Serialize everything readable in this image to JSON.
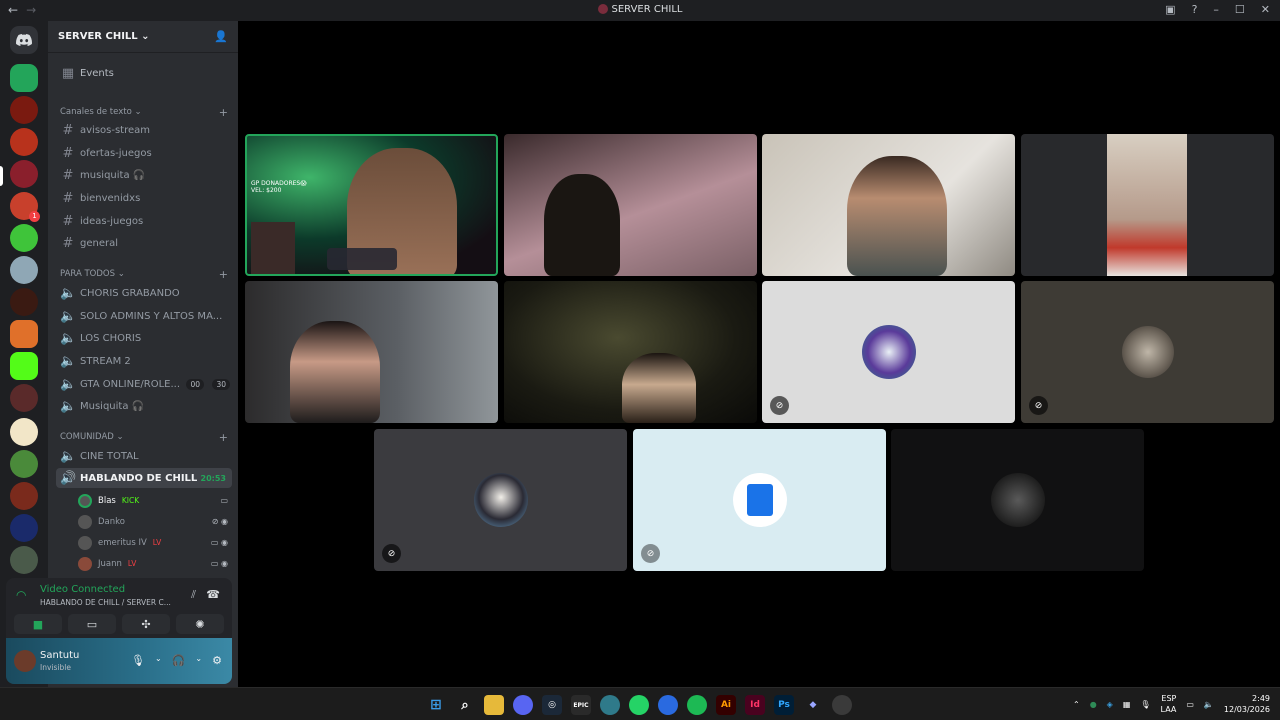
{
  "window": {
    "title": "SERVER CHILL",
    "back": "←",
    "forward": "→"
  },
  "server_header": {
    "name": "SERVER CHILL",
    "chevron": "⌄",
    "invite_icon": "person-add-icon"
  },
  "events_label": "Events",
  "categories": {
    "text": "Canales de texto",
    "all": "PARA TODOS",
    "community": "COMUNIDAD"
  },
  "text_channels": [
    "avisos-stream",
    "ofertas-juegos",
    "musiquita 🎧",
    "bienvenidxs",
    "ideas-juegos",
    "general"
  ],
  "voice_channels": [
    "CHORIS GRABANDO",
    "SOLO ADMINS Y ALTOS MA...",
    "LOS CHORIS",
    "STREAM 2",
    "GTA ONLINE/ROLE...",
    "Musiquita 🎧"
  ],
  "gta_counts": [
    "00",
    "30"
  ],
  "community_channels": [
    "CINE TOTAL",
    "HABLANDO DE CHILL"
  ],
  "active_call_time": "20:53",
  "call_users": [
    {
      "name": "Blas",
      "tag": "KICK"
    },
    {
      "name": "Danko",
      "tag": ""
    },
    {
      "name": "emeritus IV",
      "tag": "LV"
    },
    {
      "name": "Juann",
      "tag": "LV"
    }
  ],
  "voice_panel": {
    "status": "Video Connected",
    "sub": "HABLANDO DE CHILL / SERVER C..."
  },
  "user_panel": {
    "name": "Santutu",
    "status": "Invisible"
  },
  "tile_overlay": {
    "donors": "GP DONADORES😱",
    "amount": "VEL: $200"
  },
  "taskbar": {
    "lang": "ESP",
    "layout": "LAA",
    "time": "2:49",
    "date": "12/03/2026"
  },
  "colors": {
    "accent_green": "#23a55a",
    "bg_sidebar": "#2b2d31",
    "bg_rail": "#1e1f22"
  }
}
